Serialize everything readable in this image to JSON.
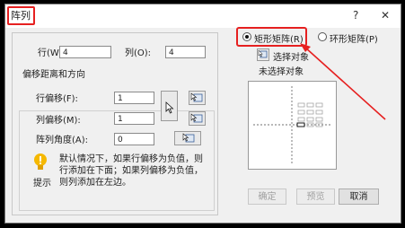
{
  "dialog": {
    "title": "阵列",
    "help_glyph": "?",
    "close_glyph": "✕"
  },
  "counts": {
    "rows_label": "行(W):",
    "rows_value": "4",
    "cols_label": "列(O):",
    "cols_value": "4"
  },
  "offset": {
    "group_title": "偏移距离和方向",
    "row_offset_label": "行偏移(F):",
    "row_offset_value": "1",
    "col_offset_label": "列偏移(M):",
    "col_offset_value": "1",
    "angle_label": "阵列角度(A):",
    "angle_value": "0"
  },
  "tip": {
    "text": "默认情况下，如果行偏移为负值，则行添加在下面；如果列偏移为负值，则列添加在左边。",
    "label": "提示"
  },
  "mode": {
    "rect_label": "矩形矩阵(R)",
    "polar_label": "环形矩阵(P)",
    "selected": "rect"
  },
  "selection": {
    "select_button_label": "选择对象",
    "status": "未选择对象"
  },
  "buttons": {
    "ok": "确定",
    "preview": "预览",
    "cancel": "取消"
  },
  "colors": {
    "highlight": "#e62020"
  }
}
